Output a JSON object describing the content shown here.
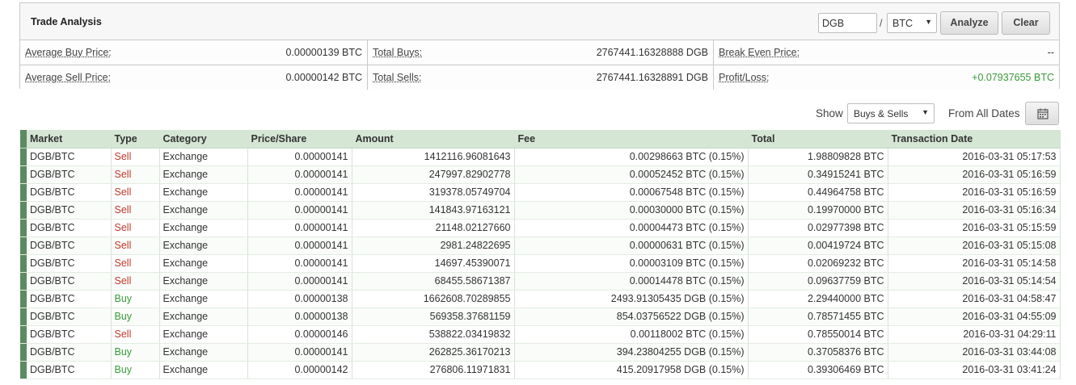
{
  "panel": {
    "title": "Trade Analysis",
    "market_input": "DGB",
    "separator": "/",
    "base_select": "BTC",
    "analyze_label": "Analyze",
    "clear_label": "Clear"
  },
  "summary": {
    "avg_buy_label": "Average Buy Price:",
    "avg_buy_value": "0.00000139 BTC",
    "total_buys_label": "Total Buys:",
    "total_buys_value": "2767441.16328888 DGB",
    "break_even_label": "Break Even Price:",
    "break_even_value": "--",
    "avg_sell_label": "Average Sell Price:",
    "avg_sell_value": "0.00000142 BTC",
    "total_sells_label": "Total Sells:",
    "total_sells_value": "2767441.16328891 DGB",
    "profit_label": "Profit/Loss:",
    "profit_value": "+0.07937655 BTC"
  },
  "filters": {
    "show_label": "Show",
    "show_value": "Buys & Sells",
    "dates_label": "From All Dates"
  },
  "colors": {
    "sell": "#c0392b",
    "buy": "#3a9a3a",
    "header_bg": "#d5e6d5",
    "row_marker": "#5c8a62"
  },
  "table": {
    "columns": [
      "Market",
      "Type",
      "Category",
      "Price/Share",
      "Amount",
      "Fee",
      "Total",
      "Transaction Date"
    ],
    "rows": [
      [
        "DGB/BTC",
        "Sell",
        "Exchange",
        "0.00000141",
        "1412116.96081643",
        "0.00298663 BTC (0.15%)",
        "1.98809828 BTC",
        "2016-03-31 05:17:53"
      ],
      [
        "DGB/BTC",
        "Sell",
        "Exchange",
        "0.00000141",
        "247997.82902778",
        "0.00052452 BTC (0.15%)",
        "0.34915241 BTC",
        "2016-03-31 05:16:59"
      ],
      [
        "DGB/BTC",
        "Sell",
        "Exchange",
        "0.00000141",
        "319378.05749704",
        "0.00067548 BTC (0.15%)",
        "0.44964758 BTC",
        "2016-03-31 05:16:59"
      ],
      [
        "DGB/BTC",
        "Sell",
        "Exchange",
        "0.00000141",
        "141843.97163121",
        "0.00030000 BTC (0.15%)",
        "0.19970000 BTC",
        "2016-03-31 05:16:34"
      ],
      [
        "DGB/BTC",
        "Sell",
        "Exchange",
        "0.00000141",
        "21148.02127660",
        "0.00004473 BTC (0.15%)",
        "0.02977398 BTC",
        "2016-03-31 05:15:59"
      ],
      [
        "DGB/BTC",
        "Sell",
        "Exchange",
        "0.00000141",
        "2981.24822695",
        "0.00000631 BTC (0.15%)",
        "0.00419724 BTC",
        "2016-03-31 05:15:08"
      ],
      [
        "DGB/BTC",
        "Sell",
        "Exchange",
        "0.00000141",
        "14697.45390071",
        "0.00003109 BTC (0.15%)",
        "0.02069232 BTC",
        "2016-03-31 05:14:58"
      ],
      [
        "DGB/BTC",
        "Sell",
        "Exchange",
        "0.00000141",
        "68455.58671387",
        "0.00014478 BTC (0.15%)",
        "0.09637759 BTC",
        "2016-03-31 05:14:54"
      ],
      [
        "DGB/BTC",
        "Buy",
        "Exchange",
        "0.00000138",
        "1662608.70289855",
        "2493.91305435 DGB (0.15%)",
        "2.29440000 BTC",
        "2016-03-31 04:58:47"
      ],
      [
        "DGB/BTC",
        "Buy",
        "Exchange",
        "0.00000138",
        "569358.37681159",
        "854.03756522 DGB (0.15%)",
        "0.78571455 BTC",
        "2016-03-31 04:55:09"
      ],
      [
        "DGB/BTC",
        "Sell",
        "Exchange",
        "0.00000146",
        "538822.03419832",
        "0.00118002 BTC (0.15%)",
        "0.78550014 BTC",
        "2016-03-31 04:29:11"
      ],
      [
        "DGB/BTC",
        "Buy",
        "Exchange",
        "0.00000141",
        "262825.36170213",
        "394.23804255 DGB (0.15%)",
        "0.37058376 BTC",
        "2016-03-31 03:44:08"
      ],
      [
        "DGB/BTC",
        "Buy",
        "Exchange",
        "0.00000142",
        "276806.11971831",
        "415.20917958 DGB (0.15%)",
        "0.39306469 BTC",
        "2016-03-31 03:41:24"
      ]
    ]
  },
  "icons": {
    "calendar": "calendar-icon",
    "dropdown": "chevron-down-icon"
  }
}
